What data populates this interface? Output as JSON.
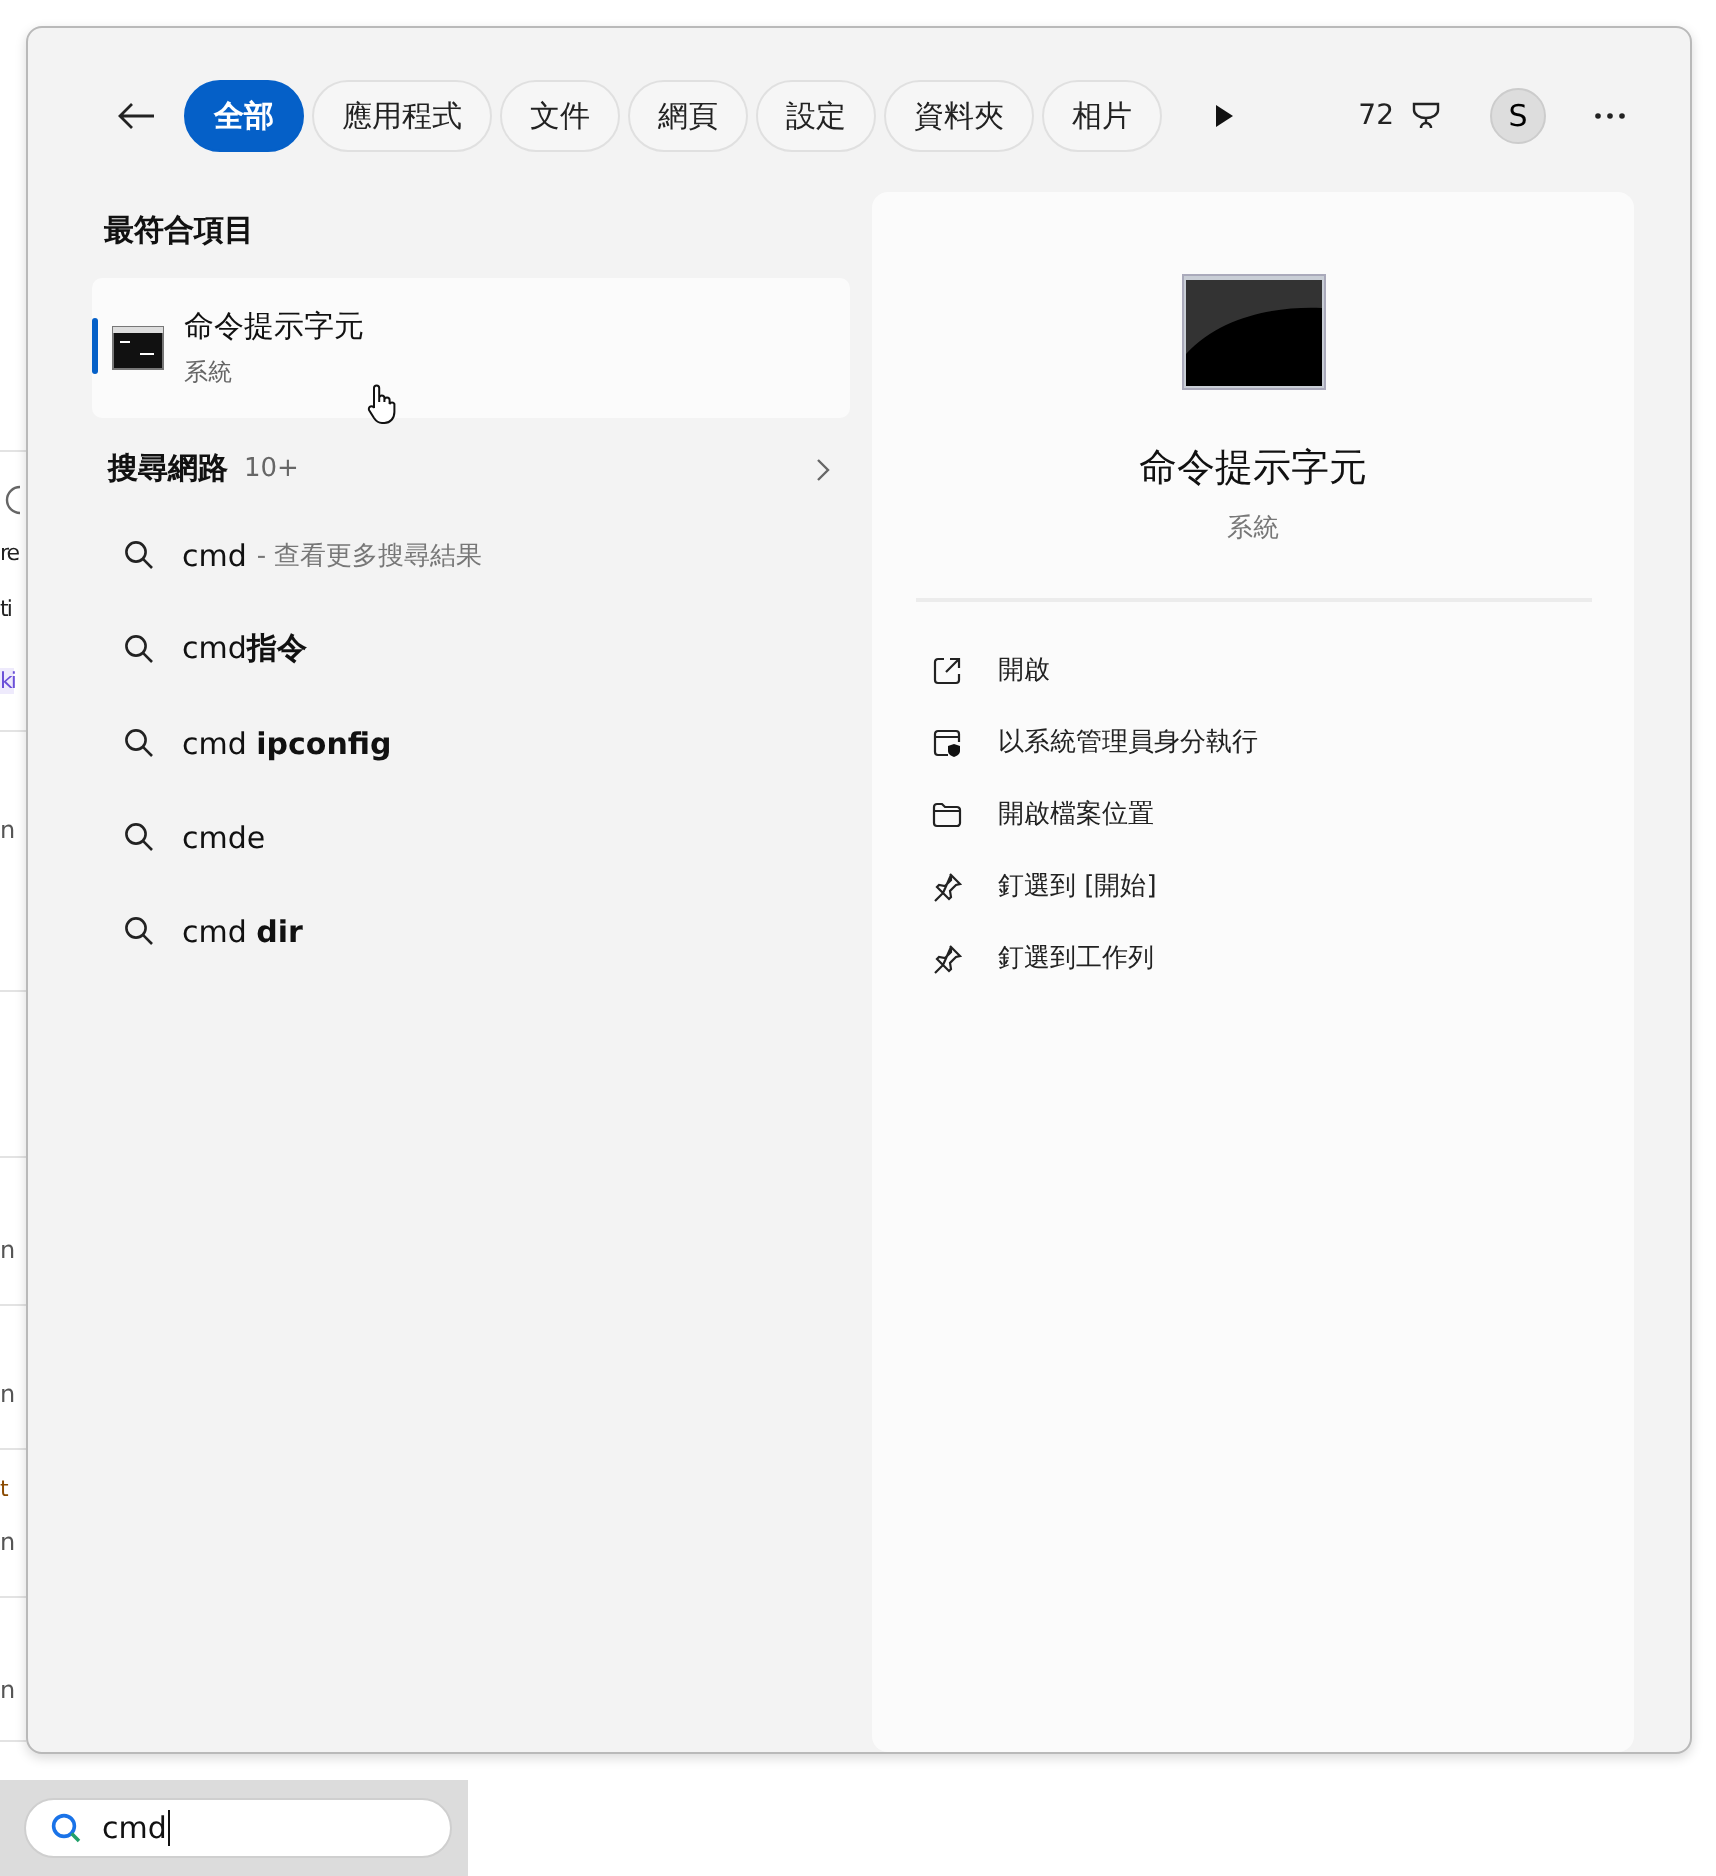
{
  "background_fragments": [
    {
      "text": "re",
      "kind": "text"
    },
    {
      "text": "ti",
      "kind": "text"
    },
    {
      "text": "ki",
      "kind": "tag"
    },
    {
      "text": "n",
      "kind": "small"
    },
    {
      "text": "n",
      "kind": "small"
    },
    {
      "text": "n",
      "kind": "small"
    },
    {
      "text": "t",
      "kind": "title"
    },
    {
      "text": "n",
      "kind": "small"
    },
    {
      "text": "n",
      "kind": "small"
    }
  ],
  "tabs": [
    {
      "label": "全部",
      "selected": true
    },
    {
      "label": "應用程式",
      "selected": false
    },
    {
      "label": "文件",
      "selected": false
    },
    {
      "label": "網頁",
      "selected": false
    },
    {
      "label": "設定",
      "selected": false
    },
    {
      "label": "資料夾",
      "selected": false
    },
    {
      "label": "相片",
      "selected": false
    }
  ],
  "points": "72",
  "avatar": "S",
  "best_match": {
    "heading": "最符合項目",
    "title": "命令提示字元",
    "subtitle": "系統",
    "selected": true
  },
  "web": {
    "heading": "搜尋網路",
    "count": "10+"
  },
  "suggestions": [
    {
      "kind": "more",
      "query": "cmd",
      "hint": "- 查看更多搜尋結果"
    },
    {
      "kind": "plain",
      "text": "cmd**指令**"
    },
    {
      "kind": "plain",
      "text": "cmd **ipconfig**"
    },
    {
      "kind": "plain",
      "text": "cmde"
    },
    {
      "kind": "plain",
      "text": "cmd **dir**"
    }
  ],
  "preview": {
    "title": "命令提示字元",
    "subtitle": "系統",
    "actions": [
      {
        "kind": "open",
        "label": "開啟"
      },
      {
        "kind": "admin",
        "label": "以系統管理員身分執行"
      },
      {
        "kind": "folder",
        "label": "開啟檔案位置"
      },
      {
        "kind": "pin",
        "label": "釘選到 [開始]"
      },
      {
        "kind": "pin",
        "label": "釘選到工作列"
      }
    ]
  },
  "search": {
    "value": "cmd"
  }
}
